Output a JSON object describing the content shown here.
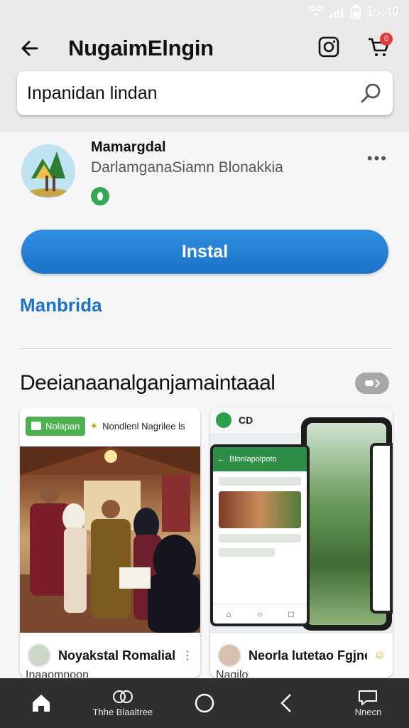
{
  "status": {
    "time": "1s:40"
  },
  "header": {
    "title": "NugaimElngin"
  },
  "cart": {
    "badge": "0"
  },
  "search": {
    "text": "Inpanidan lindan"
  },
  "app": {
    "name": "Mamargdal",
    "developer": "DarlamganaSiamn Blonakkia",
    "install_label": "Instal",
    "more_link": "Manbrida"
  },
  "section": {
    "title": "Deeianaanalganjamaintaaal"
  },
  "cards": [
    {
      "tag": "Nolapan",
      "header_text": "Nondlenl Nagrilee ls",
      "footer_name": "Noyakstal Romalial",
      "footer_sub": "Inaaomnoon"
    },
    {
      "header_text": "CD",
      "phone_header": "Blonlapolpoto",
      "footer_name": "Neorla lutetao Fgjneea",
      "footer_sub": "Nagilo"
    }
  ],
  "bottom_nav": [
    {
      "label": "",
      "icon": "home-icon"
    },
    {
      "label": "Thhe Blaaltree",
      "icon": "chat-icon"
    },
    {
      "label": "",
      "icon": "circle-icon"
    },
    {
      "label": "",
      "icon": "back-chevron-icon"
    },
    {
      "label": "Nnecn",
      "icon": "message-icon"
    }
  ],
  "colors": {
    "accent": "#1a73c8",
    "install": "#2f8fe0",
    "green": "#4caf50",
    "nav_bg": "#2f2f31"
  }
}
